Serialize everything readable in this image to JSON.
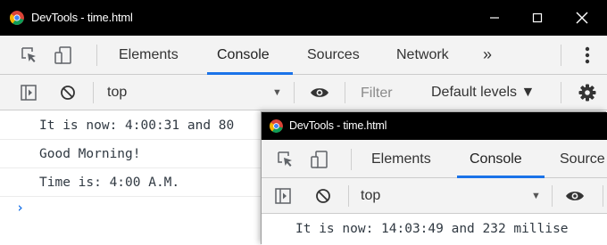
{
  "colors": {
    "titlebar_bg": "#000000",
    "toolbar_bg": "#f3f3f3",
    "accent_underline": "#1a73e8",
    "prompt_color": "#1a73e8"
  },
  "window_back": {
    "title": "DevTools - time.html",
    "tabs": [
      {
        "label": "Elements"
      },
      {
        "label": "Console",
        "active": true
      },
      {
        "label": "Sources"
      },
      {
        "label": "Network"
      }
    ],
    "overflow_label": "»",
    "context_label": "top",
    "filter_placeholder": "Filter",
    "levels_label": "Default levels ▼",
    "console_lines": [
      "It is now: 4:00:31 and 80",
      "Good Morning!",
      "Time is: 4:00 A.M."
    ],
    "prompt": "›",
    "icons": [
      "chrome-icon",
      "minimize-icon",
      "maximize-icon",
      "close-icon",
      "inspect-icon",
      "device-toggle-icon",
      "more-options-icon",
      "sidebar-toggle-icon",
      "clear-console-icon",
      "context-dropdown-icon",
      "eye-icon",
      "settings-gear-icon"
    ]
  },
  "window_front": {
    "title": "DevTools - time.html",
    "tabs": [
      {
        "label": "Elements"
      },
      {
        "label": "Console",
        "active": true
      },
      {
        "label": "Source"
      }
    ],
    "context_label": "top",
    "console_lines": [
      "It is now: 14:03:49 and 232 millise"
    ],
    "icons": [
      "chrome-icon",
      "inspect-icon",
      "device-toggle-icon",
      "sidebar-toggle-icon",
      "clear-console-icon",
      "context-dropdown-icon",
      "eye-icon"
    ]
  }
}
